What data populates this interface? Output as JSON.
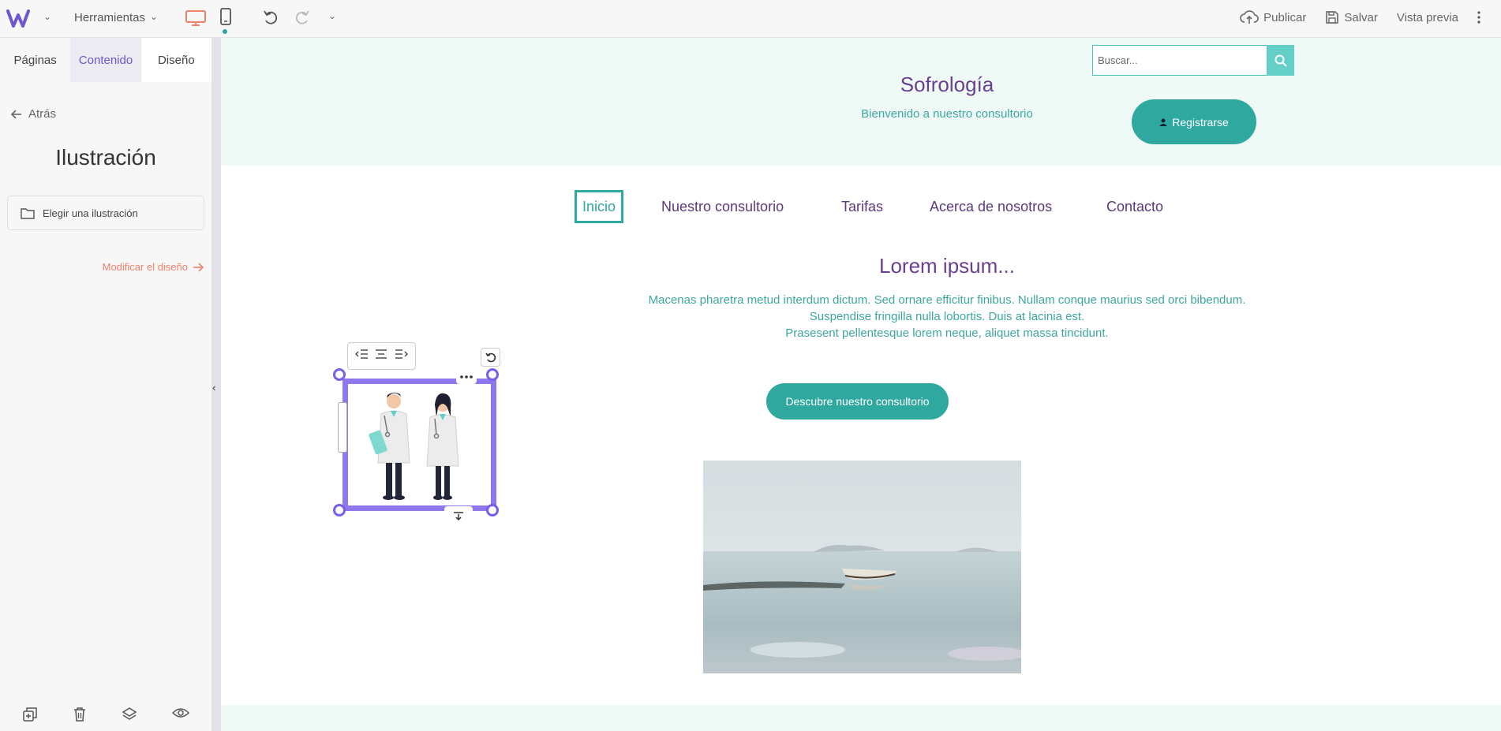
{
  "toolbar": {
    "tools_label": "Herramientas",
    "actions": [
      "Publicar",
      "Salvar",
      "Vista previa"
    ],
    "accent_color": "#f0806b",
    "brand_color": "#6e56cf"
  },
  "left_panel": {
    "tabs": [
      "Páginas",
      "Contenido",
      "Diseño"
    ],
    "active_tab": "Contenido",
    "back_label": "Atrás",
    "title": "Ilustración",
    "choose_label": "Elegir una ilustración",
    "modify_label": "Modificar el diseño",
    "bottom_icons": [
      "duplicate-icon",
      "trash-icon",
      "layers-icon",
      "eye-icon"
    ]
  },
  "site": {
    "title": "Sofrología",
    "subtitle": "Bienvenido a nuestro consultorio",
    "search_placeholder": "Buscar...",
    "register_label": "Registrarse",
    "nav": [
      "Inicio",
      "Nuestro consultorio",
      "Tarifas",
      "Acerca de nosotros",
      "Contacto"
    ],
    "active_nav": "Inicio",
    "section_title": "Lorem ipsum...",
    "section_lines": [
      "Macenas pharetra metud interdum dictum. Sed ornare efficitur finibus. Nullam conque maurius sed orci bibendum.",
      "Suspendise fringilla nulla lobortis. Duis at lacinia est.",
      "Prasesent pellentesque lorem neque, aliquet massa tincidunt."
    ],
    "cta_label": "Descubre nuestro consultorio",
    "primary_color": "#2fa8a0",
    "heading_color": "#6b3f8f"
  }
}
